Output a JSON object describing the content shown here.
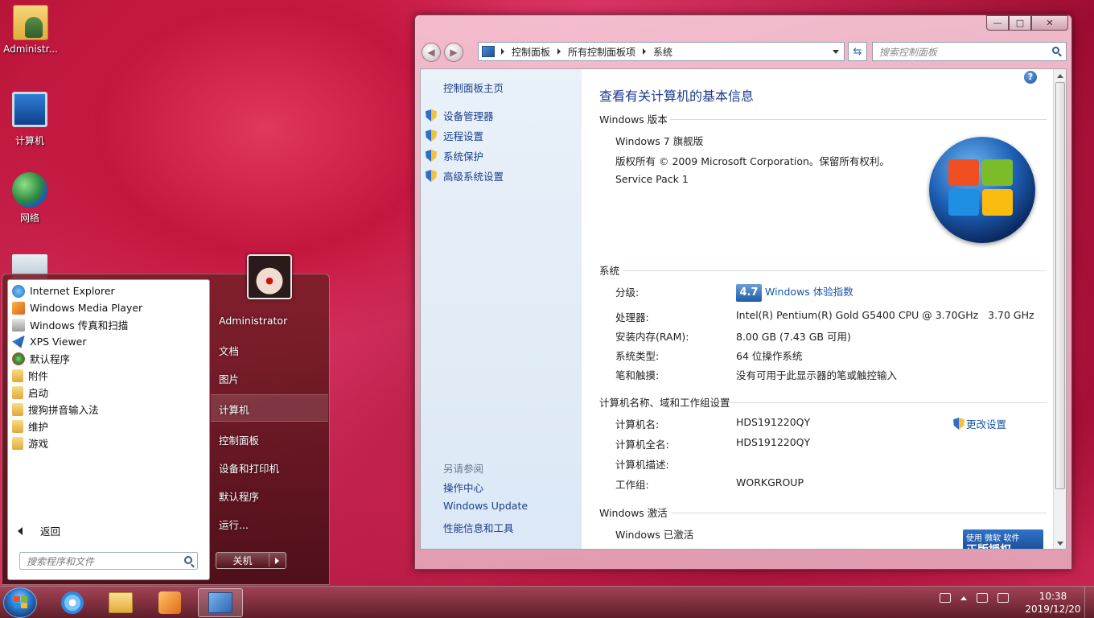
{
  "desktop": {
    "icons": [
      {
        "label": "Administr...",
        "icon": "user-folder-icon"
      },
      {
        "label": "计算机",
        "icon": "computer-icon"
      },
      {
        "label": "网络",
        "icon": "network-icon"
      },
      {
        "label": "",
        "icon": "recycle-bin-icon"
      }
    ]
  },
  "start_menu": {
    "programs": [
      {
        "label": "Internet Explorer",
        "icon": "ie-icon"
      },
      {
        "label": "Windows Media Player",
        "icon": "media-player-icon"
      },
      {
        "label": "Windows 传真和扫描",
        "icon": "fax-scan-icon"
      },
      {
        "label": "XPS Viewer",
        "icon": "xps-icon"
      },
      {
        "label": "默认程序",
        "icon": "default-programs-icon"
      },
      {
        "label": "附件",
        "icon": "folder-icon"
      },
      {
        "label": "启动",
        "icon": "folder-icon"
      },
      {
        "label": "搜狗拼音输入法",
        "icon": "folder-icon"
      },
      {
        "label": "维护",
        "icon": "folder-icon"
      },
      {
        "label": "游戏",
        "icon": "folder-icon"
      }
    ],
    "back_label": "返回",
    "search_placeholder": "搜索程序和文件",
    "right_items": [
      "Administrator",
      "文档",
      "图片",
      "计算机",
      "控制面板",
      "设备和打印机",
      "默认程序",
      "运行..."
    ],
    "highlighted_item": "计算机",
    "shutdown_label": "关机"
  },
  "window": {
    "caption": {
      "min": "—",
      "max": "□",
      "close": "✕"
    },
    "address": {
      "crumbs": [
        "控制面板",
        "所有控制面板项",
        "系统"
      ]
    },
    "search_placeholder": "搜索控制面板",
    "sidebar": {
      "home": "控制面板主页",
      "links": [
        "设备管理器",
        "远程设置",
        "系统保护",
        "高级系统设置"
      ],
      "see_also_title": "另请参阅",
      "see_also": [
        "操作中心",
        "Windows Update",
        "性能信息和工具"
      ]
    },
    "main": {
      "title": "查看有关计算机的基本信息",
      "edition": {
        "heading": "Windows 版本",
        "name": "Windows 7 旗舰版",
        "copyright": "版权所有 © 2009 Microsoft Corporation。保留所有权利。",
        "service_pack": "Service Pack 1"
      },
      "system": {
        "heading": "系统",
        "rating_label": "分级:",
        "rating_score": "4.7",
        "rating_link": "Windows 体验指数",
        "processor_label": "处理器:",
        "processor_value": "Intel(R) Pentium(R) Gold G5400 CPU @ 3.70GHz   3.70 GHz",
        "ram_label": "安装内存(RAM):",
        "ram_value": "8.00 GB (7.43 GB 可用)",
        "type_label": "系统类型:",
        "type_value": "64 位操作系统",
        "pen_label": "笔和触摸:",
        "pen_value": "没有可用于此显示器的笔或触控输入"
      },
      "computer_name": {
        "heading": "计算机名称、域和工作组设置",
        "name_label": "计算机名:",
        "name_value": "HDS191220QY",
        "full_label": "计算机全名:",
        "full_value": "HDS191220QY",
        "desc_label": "计算机描述:",
        "desc_value": "",
        "workgroup_label": "工作组:",
        "workgroup_value": "WORKGROUP",
        "change_link": "更改设置"
      },
      "activation": {
        "heading": "Windows 激活",
        "status": "Windows 已激活",
        "badge_top": "使用 微软 软件",
        "badge_bottom": "正版授权"
      },
      "help": "?"
    }
  },
  "taskbar": {
    "pinned": [
      "ie-icon",
      "explorer-folder-icon",
      "media-player-icon",
      "control-panel-icon"
    ],
    "time": "10:38",
    "date": "2019/12/20"
  }
}
